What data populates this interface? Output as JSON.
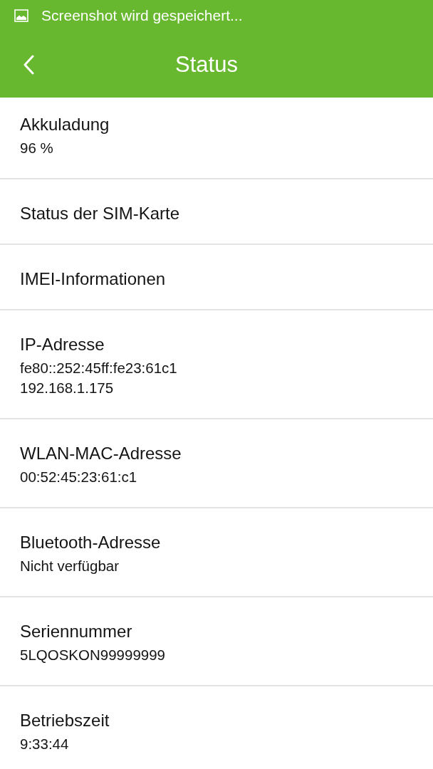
{
  "status_bar": {
    "notification": "Screenshot wird gespeichert..."
  },
  "toolbar": {
    "title": "Status"
  },
  "items": [
    {
      "title": "Akkuladung",
      "values": [
        "96 %"
      ]
    },
    {
      "title": "Status der SIM-Karte"
    },
    {
      "title": "IMEI-Informationen"
    },
    {
      "title": "IP-Adresse",
      "values": [
        "fe80::252:45ff:fe23:61c1",
        "192.168.1.175"
      ]
    },
    {
      "title": "WLAN-MAC-Adresse",
      "values": [
        "00:52:45:23:61:c1"
      ]
    },
    {
      "title": "Bluetooth-Adresse",
      "values": [
        "Nicht verfügbar"
      ]
    },
    {
      "title": "Seriennummer",
      "values": [
        "5LQOSKON99999999"
      ]
    },
    {
      "title": "Betriebszeit",
      "values": [
        "9:33:44"
      ]
    }
  ]
}
